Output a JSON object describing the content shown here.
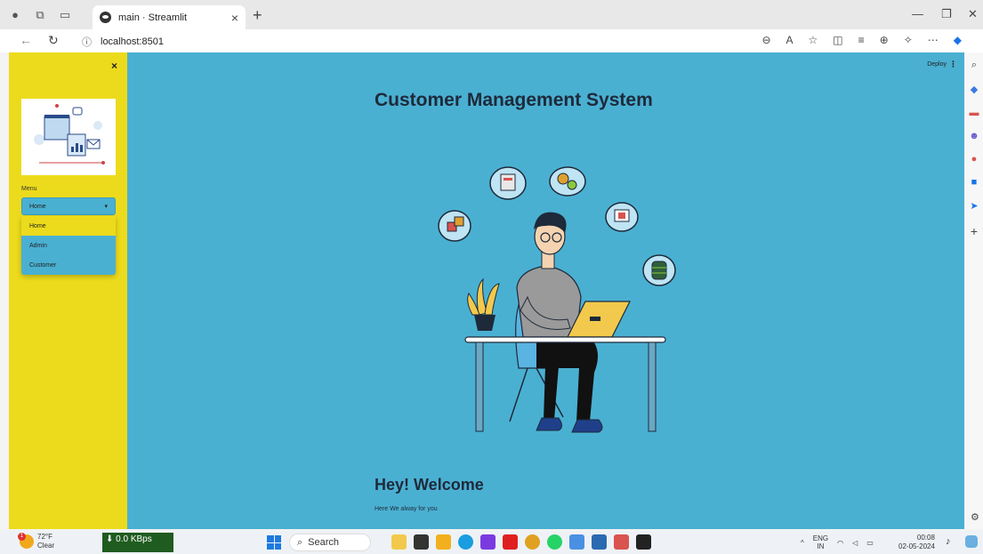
{
  "browser": {
    "tab_title": "main · Streamlit",
    "url": "localhost:8501",
    "tab_close": "×",
    "new_tab": "+"
  },
  "sidebar": {
    "close_label": "×",
    "menu_label": "Menu",
    "selected_value": "Home",
    "options": [
      "Home",
      "Admin",
      "Customer"
    ]
  },
  "header": {
    "deploy_label": "Deploy",
    "menu_dots": "⋮"
  },
  "main": {
    "title": "Customer Management System",
    "welcome_heading": "Hey! Welcome",
    "welcome_text": "Here We alway for you"
  },
  "taskbar": {
    "temperature": "72°F",
    "weather_text": "Clear",
    "weather_badge": "1",
    "net_speed": "⬇ 0.0 KBps",
    "search_label": "Search",
    "language": "ENG",
    "region": "IN",
    "time": "00:08",
    "date": "02-05-2024"
  },
  "colors": {
    "sidebar_bg": "#ecdb1c",
    "main_bg": "#4ab0d2",
    "title_color": "#1e2a3a"
  }
}
